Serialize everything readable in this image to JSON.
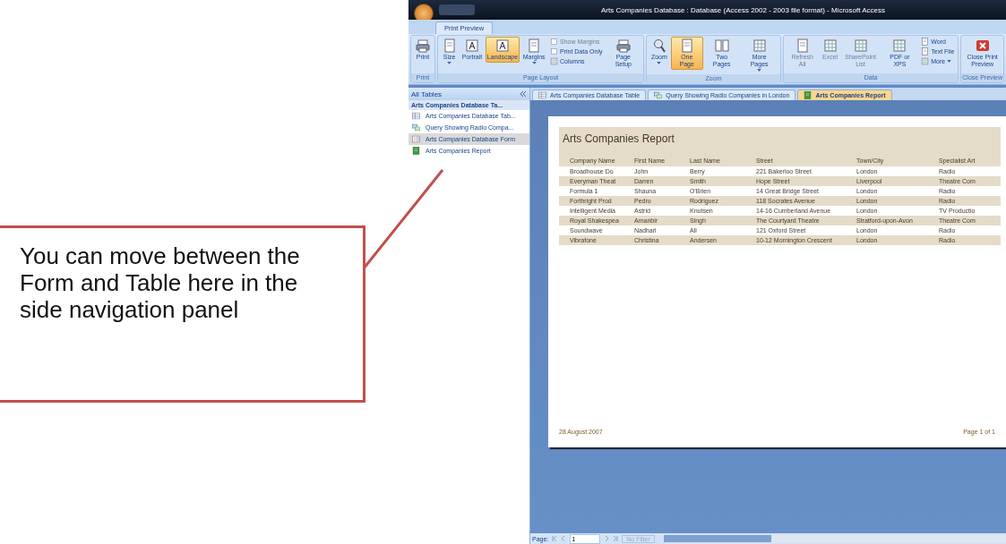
{
  "callout": {
    "text": "You can move between the Form and Table here in the side navigation panel"
  },
  "window": {
    "title": "Arts Companies Database : Database (Access 2002 - 2003 file format) - Microsoft Access"
  },
  "ribbon_tabs": [
    {
      "label": "Print Preview",
      "selected": true
    }
  ],
  "ribbon_groups": [
    {
      "label": "Print",
      "buttons": [
        {
          "label": "Print",
          "kind": "large",
          "selected": false,
          "disabled": false,
          "dropdown": false
        }
      ]
    },
    {
      "label": "Page Layout",
      "buttons": [
        {
          "label": "Size",
          "kind": "large",
          "selected": false,
          "disabled": false,
          "dropdown": true
        },
        {
          "label": "Portrait",
          "kind": "large",
          "selected": false,
          "disabled": false,
          "dropdown": false
        },
        {
          "label": "Landscape",
          "kind": "large",
          "selected": true,
          "disabled": false,
          "dropdown": false
        },
        {
          "label": "Margins",
          "kind": "large",
          "selected": false,
          "disabled": false,
          "dropdown": true
        },
        {
          "label": "Show Margins",
          "kind": "check",
          "selected": false,
          "disabled": true,
          "dropdown": false
        },
        {
          "label": "Print Data Only",
          "kind": "check",
          "selected": false,
          "disabled": false,
          "dropdown": false
        },
        {
          "label": "Columns",
          "kind": "small",
          "selected": false,
          "disabled": false,
          "dropdown": false
        },
        {
          "label": "Page Setup",
          "kind": "large",
          "selected": false,
          "disabled": false,
          "dropdown": false
        }
      ]
    },
    {
      "label": "Zoom",
      "buttons": [
        {
          "label": "Zoom",
          "kind": "large",
          "selected": false,
          "disabled": false,
          "dropdown": true
        },
        {
          "label": "One Page",
          "kind": "large",
          "selected": true,
          "disabled": false,
          "dropdown": false
        },
        {
          "label": "Two Pages",
          "kind": "large",
          "selected": false,
          "disabled": false,
          "dropdown": false
        },
        {
          "label": "More Pages",
          "kind": "large",
          "selected": false,
          "disabled": false,
          "dropdown": true
        }
      ]
    },
    {
      "label": "Data",
      "buttons": [
        {
          "label": "Refresh All",
          "kind": "large",
          "selected": false,
          "disabled": true,
          "dropdown": false
        },
        {
          "label": "Excel",
          "kind": "large",
          "selected": false,
          "disabled": true,
          "dropdown": false
        },
        {
          "label": "SharePoint List",
          "kind": "large",
          "selected": false,
          "disabled": true,
          "dropdown": false
        },
        {
          "label": "PDF or XPS",
          "kind": "large",
          "selected": false,
          "disabled": false,
          "dropdown": false
        },
        {
          "label": "Word",
          "kind": "small",
          "selected": false,
          "disabled": false,
          "dropdown": false
        },
        {
          "label": "Text File",
          "kind": "small",
          "selected": false,
          "disabled": false,
          "dropdown": false
        },
        {
          "label": "More",
          "kind": "small",
          "selected": false,
          "disabled": false,
          "dropdown": true
        }
      ]
    },
    {
      "label": "Close Preview",
      "buttons": [
        {
          "label": "Close Print Preview",
          "kind": "large",
          "selected": false,
          "disabled": false,
          "dropdown": false
        }
      ]
    }
  ],
  "nav_pane": {
    "title": "All Tables",
    "group": "Arts Companies Database Ta...",
    "items": [
      {
        "label": "Arts Companies Database Tab...",
        "kind": "table",
        "selected": false
      },
      {
        "label": "Query Showing Radio Compa...",
        "kind": "query",
        "selected": false
      },
      {
        "label": "Arts Companies Database Form",
        "kind": "form",
        "selected": true
      },
      {
        "label": "Arts Companies Report",
        "kind": "report",
        "selected": false
      }
    ]
  },
  "doc_tabs": [
    {
      "label": "Arts Companies Database Table",
      "kind": "table",
      "selected": false
    },
    {
      "label": "Query Showing Radio Companies in London",
      "kind": "query",
      "selected": false
    },
    {
      "label": "Arts Companies Report",
      "kind": "report",
      "selected": true
    }
  ],
  "report": {
    "title": "Arts Companies Report",
    "columns": [
      "Company Name",
      "First Name",
      "Last Name",
      "Street",
      "Town/City",
      "Specialist Art"
    ],
    "rows": [
      [
        "Broadhouse Do",
        "John",
        "Berry",
        "221 Bakerloo Street",
        "London",
        "Radio"
      ],
      [
        "Everyman Theat",
        "Darren",
        "Smith",
        "Hope Street",
        "Liverpool",
        "Theatre Com"
      ],
      [
        "Formula 1",
        "Shauna",
        "O'Brien",
        "14 Great Bridge Street",
        "London",
        "Radio"
      ],
      [
        "Forthright Prod",
        "Pedro",
        "Rodriguez",
        "118 Socrates Avenue",
        "London",
        "Radio"
      ],
      [
        "Intelligent Media",
        "Astrid",
        "Knutsen",
        "14-16 Cumberland Avenue",
        "London",
        "TV Productio"
      ],
      [
        "Royal Shakespea",
        "Amanbir",
        "Singh",
        "The Courtyard Theatre",
        "Stratford-upon-Avon",
        "Theatre Com"
      ],
      [
        "Soundwave",
        "Nadhari",
        "Ali",
        "121 Oxford Street",
        "London",
        "Radio"
      ],
      [
        "Vibrafone",
        "Christina",
        "Andersen",
        "10-12 Mornington Crescent",
        "London",
        "Radio"
      ]
    ],
    "date": "28 August 2007",
    "page": "Page 1 of 1"
  },
  "status_bar": {
    "label": "Page:",
    "page": "1",
    "filter": "No Filter"
  }
}
